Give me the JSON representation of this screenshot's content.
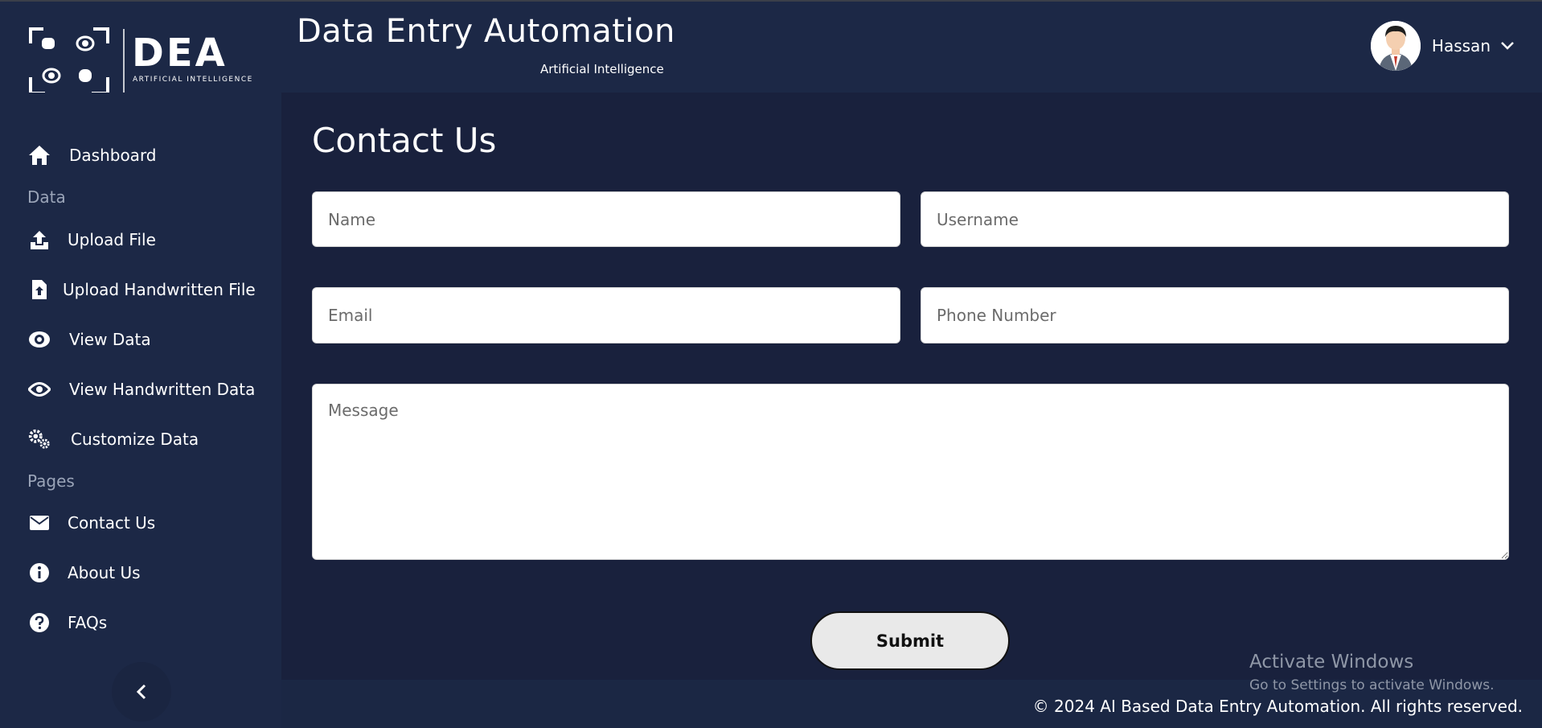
{
  "header": {
    "logo_text": "DEA",
    "logo_tagline": "ARTIFICIAL INTELLIGENCE",
    "title": "Data Entry Automation",
    "subtitle": "Artificial Intelligence",
    "user_name": "Hassan"
  },
  "sidebar": {
    "items": [
      {
        "label": "Dashboard",
        "icon": "home-icon"
      },
      {
        "label": "Upload File",
        "icon": "upload-icon"
      },
      {
        "label": "Upload Handwritten File",
        "icon": "file-upload-icon"
      },
      {
        "label": "View Data",
        "icon": "eye-icon"
      },
      {
        "label": "View Handwritten Data",
        "icon": "eye-icon"
      },
      {
        "label": "Customize Data",
        "icon": "gears-icon"
      },
      {
        "label": "Contact Us",
        "icon": "envelope-icon"
      },
      {
        "label": "About Us",
        "icon": "info-icon"
      },
      {
        "label": "FAQs",
        "icon": "question-icon"
      }
    ],
    "sections": {
      "data": "Data",
      "pages": "Pages"
    }
  },
  "main": {
    "page_title": "Contact Us",
    "form": {
      "name_placeholder": "Name",
      "username_placeholder": "Username",
      "email_placeholder": "Email",
      "phone_placeholder": "Phone Number",
      "message_placeholder": "Message",
      "submit_label": "Submit"
    }
  },
  "watermark": {
    "line1": "Activate Windows",
    "line2": "Go to Settings to activate Windows."
  },
  "footer": {
    "text": "© 2024 AI Based Data Entry Automation. All rights reserved."
  },
  "colors": {
    "background": "#1b2744",
    "main_panel": "#19213d",
    "sidebar": "#1c2846",
    "submit_bg": "#e9e9e9"
  }
}
